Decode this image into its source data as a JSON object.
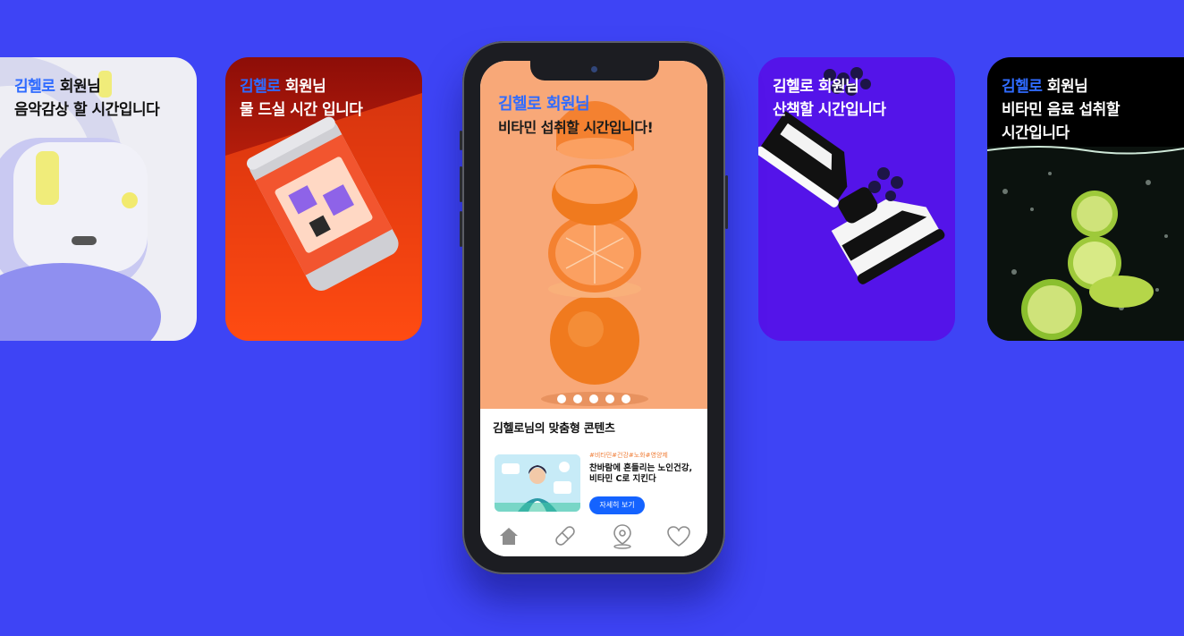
{
  "cards": [
    {
      "id": "music",
      "name": "김헬로",
      "suffix": " 회원님",
      "line2": "음악감상 할 시간입니다"
    },
    {
      "id": "water",
      "name": "김헬로",
      "suffix": " 회원님",
      "line2": "물 드실 시간 입니다"
    },
    {
      "id": "walk",
      "name": "김헬로",
      "suffix": " 회원님",
      "line2": "산책할 시간입니다"
    },
    {
      "id": "drink",
      "name": "김헬로",
      "suffix": " 회원님",
      "line2": "비타민 음료 섭취할",
      "line3": "시간입니다"
    }
  ],
  "phone": {
    "hero": {
      "name": "김헬로",
      "suffix": " 회원님",
      "line2": "비타민 섭취할 시간입니다!",
      "slide_count": 5
    },
    "content_title": "김헬로님의 맞춤형 콘텐츠",
    "article": {
      "tags": "#비타민#건강#노화#영양제",
      "title_line1": "찬바람에 흔들리는 노인건강,",
      "title_line2": "비타민 C로 지킨다",
      "button": "자세히 보기"
    },
    "tabs": [
      "home-icon",
      "pill-icon",
      "location-pin-icon",
      "heart-icon"
    ]
  },
  "colors": {
    "background": "#3e44f5",
    "accent_name": "#2f6bff",
    "button": "#1463ff"
  }
}
